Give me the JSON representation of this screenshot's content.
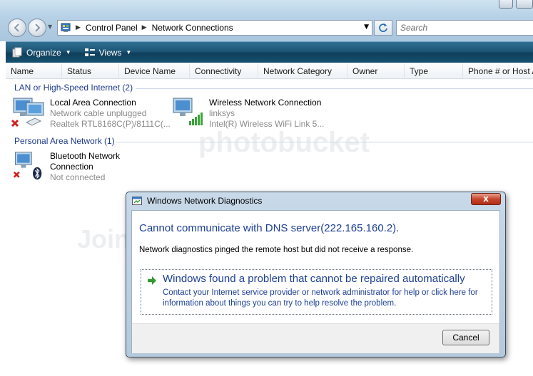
{
  "address": {
    "crumbs": [
      "Control Panel",
      "Network Connections"
    ],
    "search_placeholder": "Search"
  },
  "toolbar": {
    "organize": "Organize",
    "views": "Views"
  },
  "columns": [
    "Name",
    "Status",
    "Device Name",
    "Connectivity",
    "Network Category",
    "Owner",
    "Type",
    "Phone # or Host A"
  ],
  "groups": {
    "lan": "LAN or High-Speed Internet (2)",
    "pan": "Personal Area Network (1)"
  },
  "items": {
    "local": {
      "name": "Local Area Connection",
      "status": "Network cable unplugged",
      "device": "Realtek RTL8168C(P)/8111C(..."
    },
    "wireless": {
      "name": "Wireless Network Connection",
      "status": "linksys",
      "device": "Intel(R) Wireless WiFi Link 5..."
    },
    "bluetooth": {
      "name_line1": "Bluetooth Network",
      "name_line2": "Connection",
      "status": "Not connected"
    }
  },
  "watermark": {
    "brand": "photobucket",
    "tagline": "Join free. Share photos."
  },
  "dialog": {
    "title": "Windows Network Diagnostics",
    "close": "x",
    "heading": "Cannot communicate with DNS server(222.165.160.2).",
    "message": "Network diagnostics pinged the remote host but did not receive a response.",
    "option_title": "Windows found a problem that cannot be repaired automatically",
    "option_desc": "Contact your Internet service provider or network administrator for help or click here for information about things you can try to help resolve the problem.",
    "cancel": "Cancel"
  },
  "colors": {
    "toolbar": "#1d5576",
    "link_blue": "#1c3f94",
    "group_blue": "#1e3b8b"
  }
}
